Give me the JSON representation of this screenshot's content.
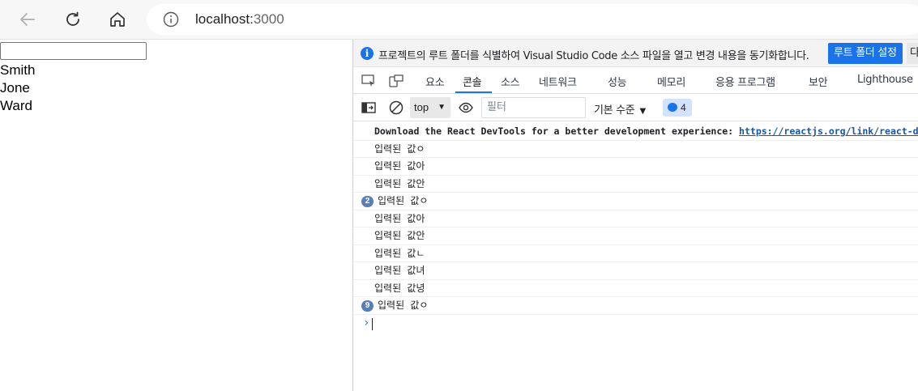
{
  "browser": {
    "url_host": "localhost:",
    "url_port": "3000",
    "icons": {
      "back": "back-arrow-icon",
      "refresh": "refresh-icon",
      "home": "home-icon",
      "info": "info-icon"
    }
  },
  "page": {
    "input_value": "",
    "names": [
      "Smith",
      "Jone",
      "Ward"
    ]
  },
  "devtools": {
    "banner": {
      "message": "프로젝트의 루트 폴더를 식별하여 Visual Studio Code 소스 파일을 열고 변경 내용을 동기화합니다.",
      "primary_button": "루트 폴더 설정",
      "secondary_button": "다"
    },
    "tabs": [
      "요소",
      "콘솔",
      "소스",
      "네트워크",
      "성능",
      "메모리",
      "응용 프로그램",
      "보안",
      "Lighthouse"
    ],
    "active_tab": "콘솔",
    "console_toolbar": {
      "context": "top",
      "filter_placeholder": "필터",
      "levels": "기본 수준",
      "message_count": "4"
    },
    "logs": [
      {
        "text": "Download the React DevTools for a better development experience: ",
        "link": "https://reactjs.org/link/react-devtools",
        "count": ""
      },
      {
        "text": "입력된 값ㅇ",
        "count": ""
      },
      {
        "text": "입력된 값아",
        "count": ""
      },
      {
        "text": "입력된 값안",
        "count": ""
      },
      {
        "text": "입력된 값ㅇ",
        "count": "2"
      },
      {
        "text": "입력된 값아",
        "count": ""
      },
      {
        "text": "입력된 값안",
        "count": ""
      },
      {
        "text": "입력된 값ㄴ",
        "count": ""
      },
      {
        "text": "입력된 값녀",
        "count": ""
      },
      {
        "text": "입력된 값녕",
        "count": ""
      },
      {
        "text": "입력된 값ㅇ",
        "count": "9"
      }
    ],
    "accent_color": "#1a73e8"
  }
}
